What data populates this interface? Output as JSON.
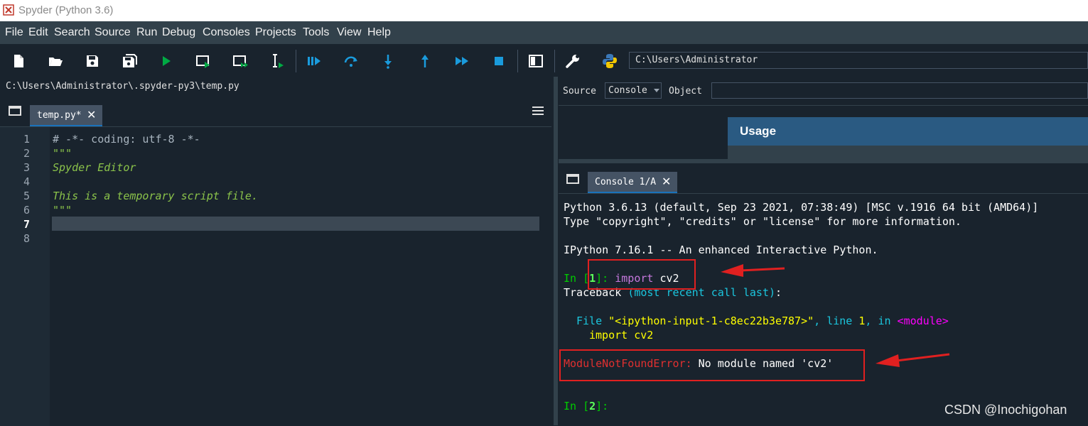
{
  "window": {
    "title": "Spyder (Python 3.6)"
  },
  "menu": [
    "File",
    "Edit",
    "Search",
    "Source",
    "Run",
    "Debug",
    "Consoles",
    "Projects",
    "Tools",
    "View",
    "Help"
  ],
  "toolbar": {
    "icons": [
      "new-file-icon",
      "open-folder-icon",
      "save-icon",
      "save-all-icon",
      "run-icon",
      "run-cell-icon",
      "run-cell-advance-icon",
      "run-selection-icon",
      "debug-icon",
      "step-icon",
      "step-into-icon",
      "step-return-icon",
      "continue-icon",
      "stop-icon",
      "maximize-pane-icon",
      "preferences-wrench-icon",
      "python-path-icon"
    ],
    "working_dir": "C:\\Users\\Administrator"
  },
  "editor": {
    "file_path": "C:\\Users\\Administrator\\.spyder-py3\\temp.py",
    "tab_label": "temp.py*",
    "current_line": 7,
    "line_numbers": [
      "1",
      "2",
      "3",
      "4",
      "5",
      "6",
      "7",
      "8"
    ],
    "lines": [
      "# -*- coding: utf-8 -*-",
      "\"\"\"",
      "Spyder Editor",
      "",
      "This is a temporary script file.",
      "\"\"\"",
      "",
      ""
    ]
  },
  "help": {
    "source_label": "Source",
    "source_value": "Console",
    "object_label": "Object",
    "usage_title": "Usage"
  },
  "console": {
    "tab_label": "Console 1/A",
    "banner1": "Python 3.6.13 (default, Sep 23 2021, 07:38:49) [MSC v.1916 64 bit (AMD64)]",
    "banner2": "Type \"copyright\", \"credits\" or \"license\" for more information.",
    "banner3": "IPython 7.16.1 -- An enhanced Interactive Python.",
    "in_prefix": "In [",
    "in_suffix": "]: ",
    "in1_num": "1",
    "in1_kw": "import",
    "in1_rest": " cv2",
    "tb_title": "Traceback ",
    "tb_paren": "(most recent call last)",
    "tb_colon": ":",
    "file_kw": "File ",
    "file_str": "\"<ipython-input-1-c8ec22b3e787>\"",
    "file_mid": ", line ",
    "file_lineno": "1",
    "file_in": ", in ",
    "file_module": "<module>",
    "import_line": "import cv2",
    "err_name": "ModuleNotFoundError:",
    "err_msg": " No module named 'cv2'",
    "in2_num": "2",
    "in2_suffix": "]:"
  },
  "colors": {
    "background": "#19232d",
    "panel": "#32414b",
    "accent": "#1a72bb",
    "annotation": "#e02020"
  },
  "watermark": "CSDN @Inochigohan"
}
